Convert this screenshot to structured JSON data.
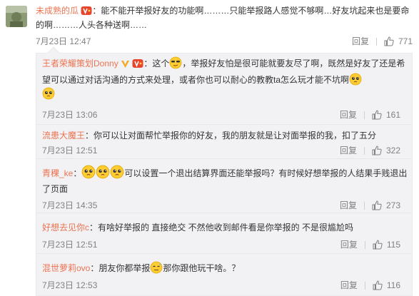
{
  "main_comment": {
    "user": "未成熟的瓜",
    "text": "：能不能开举报好友的功能啊………只能举报路人感觉不够啊…好友坑起来也是要命的啊………人头各种送啊……",
    "time": "7月23日 12:47",
    "reply_label": "回复",
    "likes": "771"
  },
  "replies": [
    {
      "user": "王者荣耀策划Donny",
      "text_a": "：这个",
      "text_b": "，举报好友怕是很可能就要友尽了啊，既然是好友了还是希望可以通过对话沟通的方式来处理，或者你也可以耐心的教教ta怎么玩才能不坑啊",
      "time": "7月23日 13:06",
      "reply_label": "回复",
      "likes": "161"
    },
    {
      "user": "流患大魔王",
      "text": "：你可以让对面帮忙举报你的好友，我的朋友就是让对面举报的我，扣了五分",
      "time": "7月23日 12:51",
      "reply_label": "回复",
      "likes": "322"
    },
    {
      "user": "青稞_ke",
      "text_a": "：",
      "text_b": "可以设置一个退出结算界面还能举报吗？有时候好想举报的人结果手贱退出了页面",
      "time": "7月23日 14:35",
      "reply_label": "回复",
      "likes": "273"
    },
    {
      "user": "好想去见你c",
      "text": "：有啥好举报的 直接绝交 不然他收到邮件看是你举报的 不是很尴尬吗",
      "time": "7月23日 12:51",
      "reply_label": "回复",
      "likes": "115"
    },
    {
      "user": "混世萝莉ovo",
      "text_a": "：朋友你都举报",
      "text_b": "那你跟他玩干啥。？",
      "time": "7月23日 12:53",
      "reply_label": "回复",
      "likes": "116"
    }
  ],
  "colors": {
    "username": "#eb7350",
    "meta": "#808080",
    "reply_bg": "#f2f2f5",
    "badge_red": "#e6452e",
    "verified_gold": "#f5a623"
  }
}
